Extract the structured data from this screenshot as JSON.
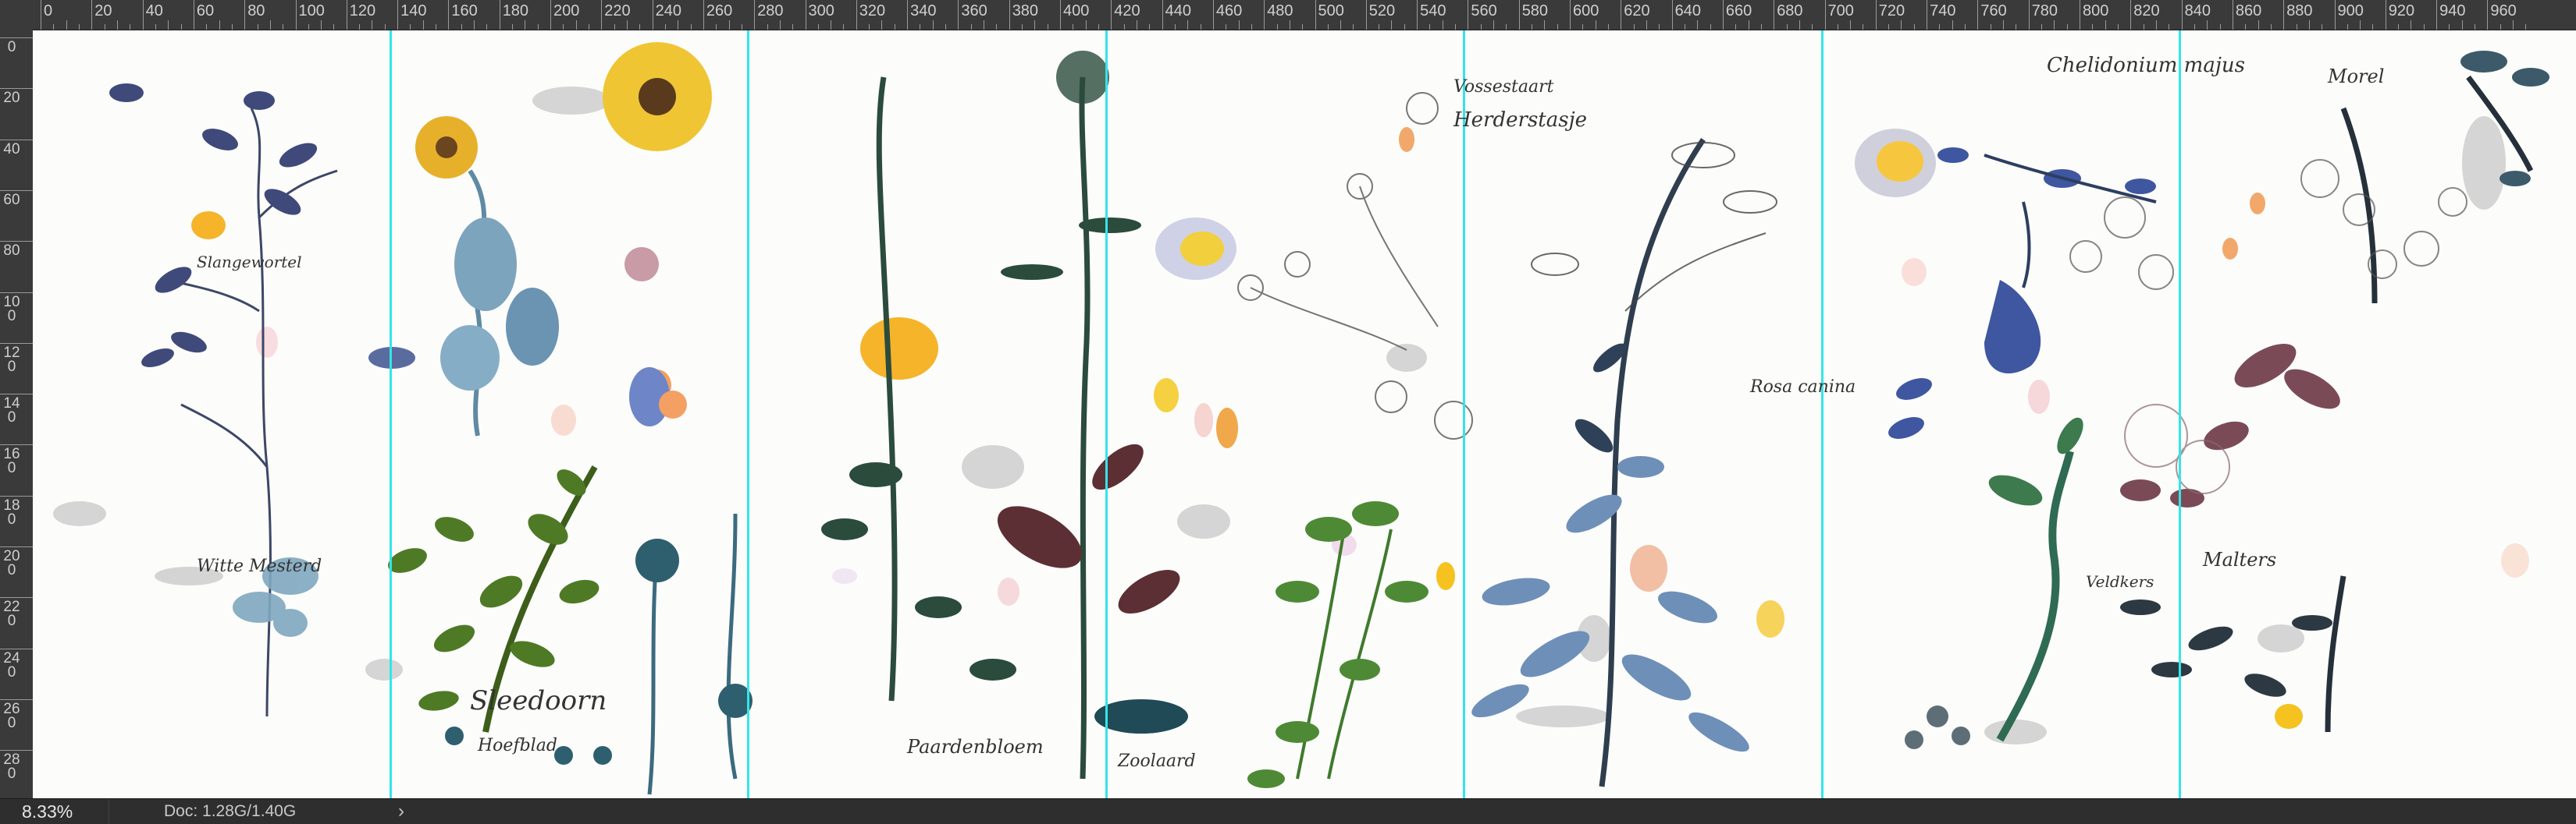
{
  "ruler": {
    "horizontal_labels": [
      "0",
      "20",
      "40",
      "60",
      "80",
      "100",
      "120",
      "140",
      "160",
      "180",
      "200",
      "220",
      "240",
      "260",
      "280",
      "300",
      "320",
      "340",
      "360",
      "380",
      "400",
      "420",
      "440",
      "460",
      "480",
      "500",
      "520",
      "540",
      "560",
      "580",
      "600",
      "620",
      "640",
      "660",
      "680",
      "700",
      "720",
      "740",
      "760",
      "780",
      "800",
      "820",
      "840",
      "860",
      "880",
      "900",
      "920",
      "940",
      "960"
    ],
    "vertical_labels": [
      "0",
      "20",
      "40",
      "60",
      "80",
      "100",
      "120",
      "140",
      "160",
      "180",
      "200",
      "220",
      "240",
      "260",
      "280"
    ]
  },
  "canvas": {
    "guides": 6,
    "annotations": [
      "Sleedoorn",
      "Hoefblad",
      "Paardenbloem",
      "Zoolaard",
      "Vossestaart",
      "Herderstasje",
      "Witte Mesterd",
      "Chelidonium majus",
      "Morel",
      "Malters",
      "Rosa canina",
      "Veldkers",
      "Slangewortel"
    ]
  },
  "status_bar": {
    "zoom": "8.33%",
    "doc_info": "Doc: 1.28G/1.40G",
    "arrow": "›"
  },
  "colors": {
    "guide": "#34e5e8",
    "canvas": "#fcfcfb",
    "ruler_bg": "#3a3a3a",
    "status_bg": "#2e2e2e"
  }
}
